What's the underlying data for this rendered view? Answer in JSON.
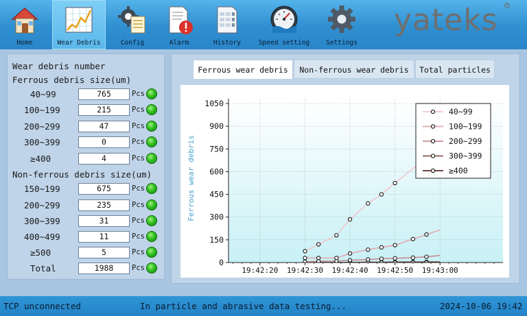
{
  "toolbar": {
    "items": [
      {
        "label": "Home",
        "icon": "home-icon"
      },
      {
        "label": "Wear Debris",
        "icon": "chart-icon"
      },
      {
        "label": "Config",
        "icon": "config-gear-icon"
      },
      {
        "label": "Alarm",
        "icon": "alarm-document-icon"
      },
      {
        "label": "History",
        "icon": "history-table-icon"
      },
      {
        "label": "Speed setting",
        "icon": "speedometer-icon"
      },
      {
        "label": "Settings",
        "icon": "gear-icon"
      }
    ],
    "active": "Wear Debris",
    "logo": "yateks",
    "logo_mark": "R"
  },
  "left": {
    "title": "Wear debris number",
    "ferrous_header": "Ferrous debris size(um)",
    "ferrous_rows": [
      {
        "range": "40~99",
        "value": "765",
        "unit": "Pcs"
      },
      {
        "range": "100~199",
        "value": "215",
        "unit": "Pcs"
      },
      {
        "range": "200~299",
        "value": "47",
        "unit": "Pcs"
      },
      {
        "range": "300~399",
        "value": "0",
        "unit": "Pcs"
      },
      {
        "range": "≥400",
        "value": "4",
        "unit": "Pcs"
      }
    ],
    "nonferrous_header": "Non-ferrous debris size(um)",
    "nonferrous_rows": [
      {
        "range": "150~199",
        "value": "675",
        "unit": "Pcs"
      },
      {
        "range": "200~299",
        "value": "235",
        "unit": "Pcs"
      },
      {
        "range": "300~399",
        "value": "31",
        "unit": "Pcs"
      },
      {
        "range": "400~499",
        "value": "11",
        "unit": "Pcs"
      },
      {
        "range": "≥500",
        "value": "5",
        "unit": "Pcs"
      }
    ],
    "total": {
      "label": "Total",
      "value": "1988",
      "unit": "Pcs"
    }
  },
  "tabs": [
    {
      "label": "Ferrous wear debris",
      "active": true
    },
    {
      "label": "Non-ferrous wear debris",
      "active": false
    },
    {
      "label": "Total particles",
      "active": false
    }
  ],
  "chart_data": {
    "type": "line",
    "ylabel": "Ferrous wear debris",
    "xlabel": "",
    "ylim": [
      0,
      1050
    ],
    "yticks": [
      "0",
      "150",
      "300",
      "450",
      "600",
      "750",
      "900",
      "1050"
    ],
    "xticks": [
      "19:42:20",
      "19:42:30",
      "19:42:40",
      "19:42:50",
      "19:43:00"
    ],
    "x": [
      "19:42:30",
      "19:42:33",
      "19:42:37",
      "19:42:40",
      "19:42:44",
      "19:42:47",
      "19:42:50",
      "19:42:54",
      "19:42:57",
      "19:43:00"
    ],
    "grid": true,
    "legend_position": "top-right",
    "series": [
      {
        "name": "40~99",
        "color": "#f2c6cc",
        "values": [
          75,
          120,
          180,
          285,
          390,
          450,
          525,
          620,
          690,
          765
        ],
        "markers": [
          true,
          true,
          true,
          true,
          true,
          true,
          true,
          false,
          false,
          false
        ]
      },
      {
        "name": "100~199",
        "color": "#e4a7ae",
        "values": [
          30,
          30,
          30,
          60,
          85,
          100,
          115,
          155,
          185,
          215
        ],
        "markers": [
          true,
          true,
          true,
          true,
          true,
          true,
          true,
          true,
          true,
          false
        ]
      },
      {
        "name": "200~299",
        "color": "#c98c8f",
        "values": [
          5,
          8,
          10,
          15,
          20,
          25,
          28,
          32,
          38,
          47
        ],
        "markers": [
          true,
          true,
          true,
          true,
          true,
          true,
          true,
          true,
          true,
          false
        ]
      },
      {
        "name": "300~399",
        "color": "#8a5a55",
        "values": [
          0,
          0,
          0,
          0,
          0,
          0,
          0,
          0,
          0,
          0
        ],
        "markers": [
          true,
          true,
          true,
          true,
          true,
          true,
          true,
          true,
          true,
          false
        ]
      },
      {
        "name": "≥400",
        "color": "#5a2e2a",
        "values": [
          0,
          0,
          1,
          1,
          2,
          2,
          3,
          3,
          4,
          4
        ],
        "markers": [
          true,
          true,
          true,
          true,
          true,
          true,
          true,
          true,
          true,
          false
        ]
      }
    ]
  },
  "status": {
    "connection": "TCP unconnected",
    "message": "In particle and abrasive data testing...",
    "datetime": "2024-10-06 19:42"
  }
}
